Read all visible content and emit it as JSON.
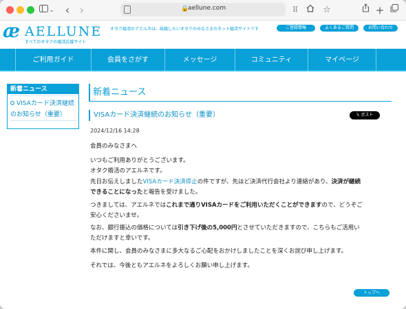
{
  "browser": {
    "url": "aellune.com",
    "nav_back": "‹",
    "nav_forward": "›"
  },
  "site": {
    "logo_mark": "æ",
    "logo_name": "AELLUNE",
    "logo_subtitle": "すべてのオタクの婚活応援サイト",
    "tagline": "オタク婚活のアエルネは、結婚したいオタクのみなさまのネット婚活サイトです",
    "header_buttons": [
      "ご登録情報",
      "よくあるご質問",
      "お問い合わせ"
    ],
    "nav": [
      "ご利用ガイド",
      "会員をさがす",
      "メッセージ",
      "コミュニティ",
      "マイページ"
    ]
  },
  "sidebar": {
    "heading": "新着ニュース",
    "link_line1": "VISAカード決済継続",
    "link_line2": "のお知らせ（重要）"
  },
  "main": {
    "section_title": "新着ニュース",
    "article_title": "VISAカード決済継続のお知らせ（重要）",
    "post_button": "𝕏 ポスト",
    "date": "2024/12/16 14:28",
    "p1": "会員のみなさまへ",
    "p2_l1": "いつもご利用ありがとうございます。",
    "p2_l2": "オタク婚活のアエルネです。",
    "p3_a": "先日お伝えしました",
    "p3_link": "VISAカード決済停止",
    "p3_b": "の件ですが、先ほど決済代行会社より連絡があり、",
    "p3_bold1": "決済が継続",
    "p3_bold2": "できることになった",
    "p3_c": "と報告を受けました。",
    "p4_a": "つきましては、アエルネでは",
    "p4_bold": "これまで通りVISAカードをご利用いただくことができます",
    "p4_b": "ので、どうぞご",
    "p4_c": "安心くださいませ。",
    "p5_a": "なお、銀行振込の価格については",
    "p5_bold": "引き下げ後の5,000円",
    "p5_b": "とさせていただきますので、こちらもご活用い",
    "p5_c": "ただけますと幸いです。",
    "p6": "本件に関し、会員のみなさまに多大なるご心配をおかけしましたことを深くお詫び申し上げます。",
    "p7": "それでは、今後ともアエルネをよろしくお願い申し上げます。",
    "top_button": "トップへ"
  }
}
